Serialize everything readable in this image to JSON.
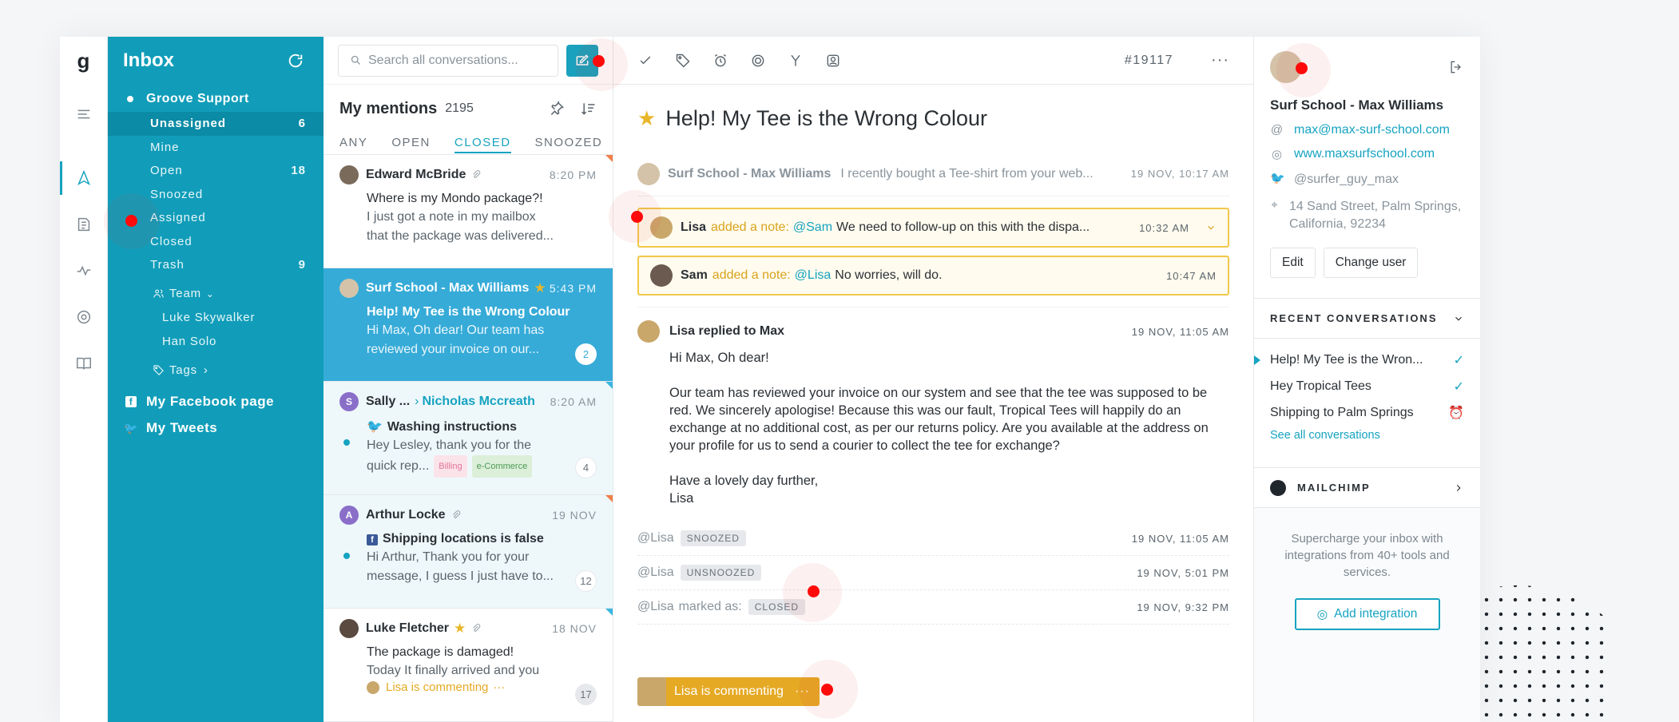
{
  "rail": {
    "logo": "g"
  },
  "folders": {
    "title": "Inbox",
    "group": "Groove Support",
    "items": [
      {
        "label": "Unassigned",
        "count": "6"
      },
      {
        "label": "Mine",
        "count": ""
      },
      {
        "label": "Open",
        "count": "18"
      },
      {
        "label": "Snoozed",
        "count": ""
      },
      {
        "label": "Assigned",
        "count": ""
      },
      {
        "label": "Closed",
        "count": ""
      },
      {
        "label": "Trash",
        "count": "9"
      }
    ],
    "team_label": "Team",
    "team_members": [
      "Luke Skywalker",
      "Han Solo"
    ],
    "tags_label": "Tags",
    "facebook": "My Facebook page",
    "tweets": "My Tweets"
  },
  "convlist": {
    "search_placeholder": "Search all conversations...",
    "heading": "My mentions",
    "count": "2195",
    "tabs": [
      "ANY",
      "OPEN",
      "CLOSED",
      "SNOOZED"
    ],
    "items": [
      {
        "name": "Edward McBride",
        "time": "8:20 PM",
        "subject": "Where is my Mondo package?!",
        "preview": "I just got a note in my mailbox that the package was delivered...",
        "badge": ""
      },
      {
        "name": "Surf School - Max Williams",
        "time": "5:43 PM",
        "subject": "Help! My Tee is the Wrong Colour",
        "preview": "Hi Max, Oh dear! Our team has reviewed your invoice on our...",
        "badge": "2"
      },
      {
        "name": "Sally ...",
        "assignee": "Nicholas Mccreath",
        "time": "8:20 AM",
        "subject": "Washing instructions",
        "preview": "Hey Lesley, thank you for the quick rep...",
        "tag1": "Billing",
        "tag2": "e-Commerce",
        "badge": "4"
      },
      {
        "name": "Arthur Locke",
        "time": "19 NOV",
        "subject": "Shipping locations is false",
        "preview": "Hi Arthur, Thank you for your message, I guess I just have to...",
        "badge": "12"
      },
      {
        "name": "Luke Fletcher",
        "time": "18 NOV",
        "subject": "The package is damaged!",
        "preview": "Today It finally arrived and you",
        "commenting": "Lisa is commenting",
        "badge": "17"
      }
    ]
  },
  "main": {
    "ticket_number": "#19117",
    "subject": "Help! My Tee is the Wrong Colour",
    "collapsed": {
      "who": "Surf School - Max Williams",
      "text": "I recently bought a Tee-shirt from your web...",
      "time": "19 NOV, 10:17 AM"
    },
    "notes": [
      {
        "who": "Lisa",
        "action": "added a note:",
        "mention": "@Sam",
        "text": "We need to follow-up on this with the dispa...",
        "time": "10:32 AM"
      },
      {
        "who": "Sam",
        "action": "added a note:",
        "mention": "@Lisa",
        "text": "No worries, will do.",
        "time": "10:47 AM"
      }
    ],
    "reply": {
      "header": "Lisa replied to Max",
      "time": "19 NOV, 11:05 AM",
      "greeting": "Hi Max, Oh dear!",
      "body": "Our team has reviewed your invoice on our system and see that the tee was supposed to be red. We sincerely apologise! Because this was our fault, Tropical Tees will happily do an exchange at no additional cost, as per our returns policy. Are you available at the address on your profile for us to send a courier to collect the tee for exchange?",
      "signoff": "Have a lovely day further,",
      "signature": "Lisa"
    },
    "events": [
      {
        "who": "@Lisa",
        "text": "",
        "pill": "SNOOZED",
        "time": "19 NOV, 11:05 AM"
      },
      {
        "who": "@Lisa",
        "text": "",
        "pill": "UNSNOOZED",
        "time": "19 NOV, 5:01 PM"
      },
      {
        "who": "@Lisa",
        "text": "marked as:",
        "pill": "CLOSED",
        "time": "19 NOV, 9:32 PM"
      }
    ],
    "commenting": "Lisa is commenting",
    "commenting_dots": "···"
  },
  "right": {
    "name": "Surf School - Max Williams",
    "email": "max@max-surf-school.com",
    "website": "www.maxsurfschool.com",
    "twitter": "@surfer_guy_max",
    "address": "14 Sand Street, Palm Springs, California, 92234",
    "edit": "Edit",
    "change_user": "Change user",
    "recent_heading": "RECENT CONVERSATIONS",
    "recent": [
      {
        "label": "Help! My Tee is the Wron...",
        "status": "✓"
      },
      {
        "label": "Hey Tropical Tees",
        "status": "✓"
      },
      {
        "label": "Shipping to Palm Springs",
        "status": "⏰"
      }
    ],
    "see_all": "See all conversations",
    "mailchimp": "MAILCHIMP",
    "promo": "Supercharge your inbox with integrations from 40+ tools and services.",
    "add_integration": "Add integration"
  },
  "colors": {
    "brand": "#119db9",
    "accent": "#16a3c0",
    "selected_item": "#36abd8",
    "note_border": "#f0c84a",
    "marker": "#ff0a0a"
  }
}
